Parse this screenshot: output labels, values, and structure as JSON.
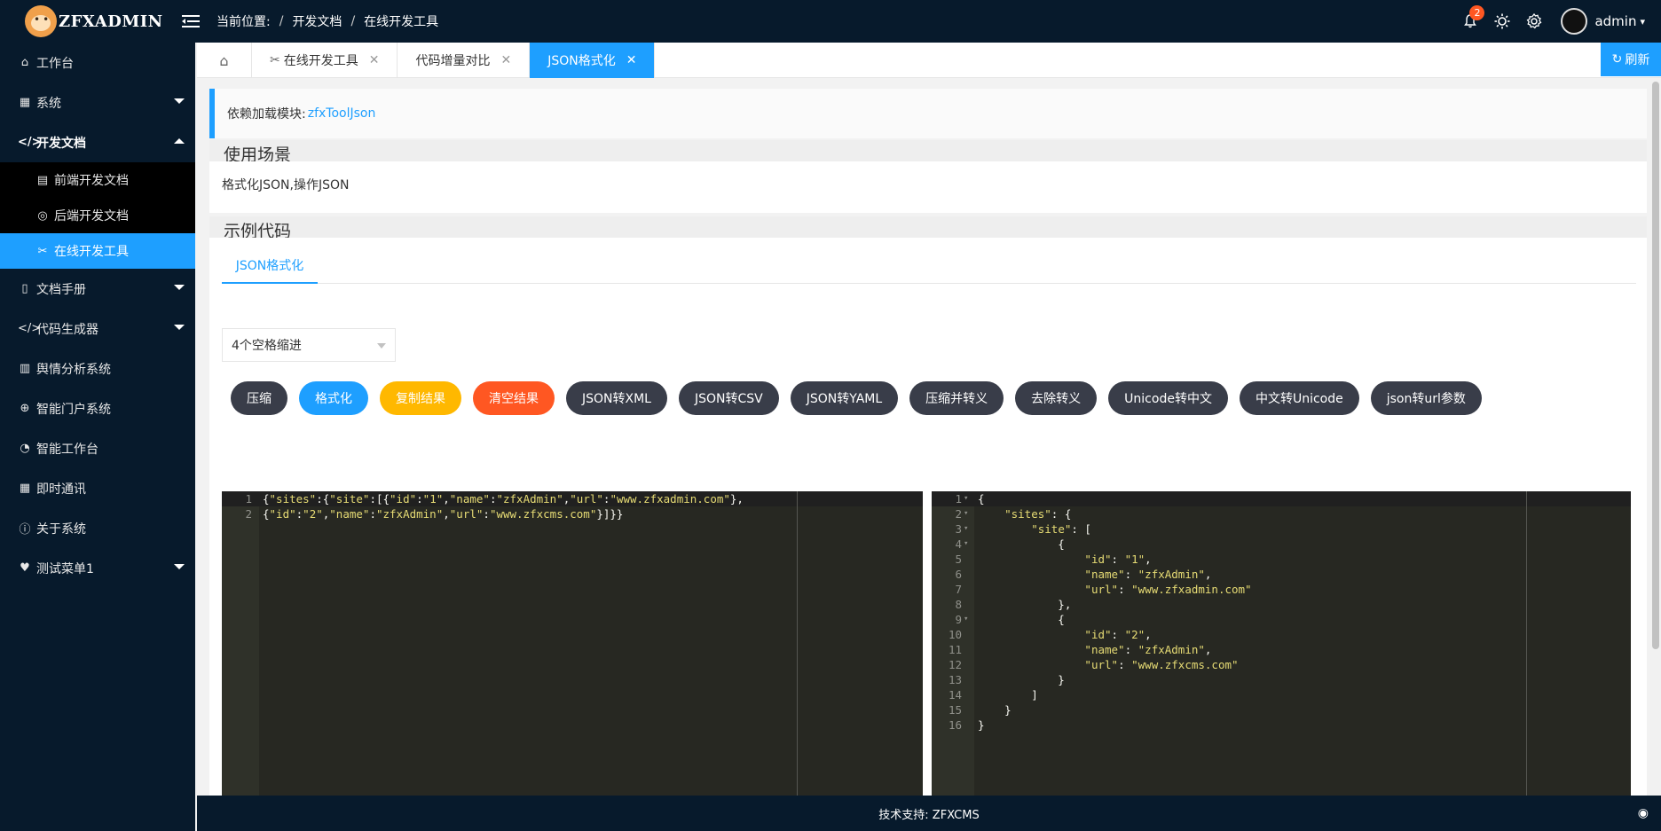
{
  "header": {
    "logo_text": "ZFXADMIN",
    "breadcrumb_label": "当前位置:",
    "breadcrumb": [
      "开发文档",
      "在线开发工具"
    ],
    "notification_count": "2",
    "user_name": "admin"
  },
  "sidebar": {
    "items": [
      {
        "label": "工作台",
        "icon": "home-icon"
      },
      {
        "label": "系统",
        "icon": "apps-icon",
        "arrow": "down"
      },
      {
        "label": "开发文档",
        "icon": "code-icon",
        "arrow": "up",
        "open": true
      },
      {
        "label": "文档手册",
        "icon": "book-icon",
        "arrow": "down"
      },
      {
        "label": "代码生成器",
        "icon": "code-icon",
        "arrow": "down"
      },
      {
        "label": "舆情分析系统",
        "icon": "docs-icon"
      },
      {
        "label": "智能门户系统",
        "icon": "globe-icon"
      },
      {
        "label": "智能工作台",
        "icon": "dashboard-icon"
      },
      {
        "label": "即时通讯",
        "icon": "apps-icon"
      },
      {
        "label": "关于系统",
        "icon": "info-icon"
      },
      {
        "label": "测试菜单1",
        "icon": "heart-icon",
        "arrow": "down"
      }
    ],
    "subitems": [
      {
        "label": "前端开发文档",
        "icon": "doc-icon"
      },
      {
        "label": "后端开发文档",
        "icon": "code-circle-icon"
      },
      {
        "label": "在线开发工具",
        "icon": "tools-icon",
        "active": true
      }
    ]
  },
  "tabs": [
    {
      "label": "在线开发工具"
    },
    {
      "label": "代码增量对比"
    },
    {
      "label": "JSON格式化",
      "active": true
    }
  ],
  "refresh_label": "刷新",
  "content": {
    "dependency_label": "依赖加载模块:",
    "dependency_module": "zfxToolJson",
    "usage_title": "使用场景",
    "usage_text": "格式化JSON,操作JSON",
    "example_title": "示例代码",
    "inner_tab": "JSON格式化",
    "indent_select": "4个空格缩进",
    "buttons": [
      {
        "label": "压缩",
        "style": "dark"
      },
      {
        "label": "格式化",
        "style": "blue"
      },
      {
        "label": "复制结果",
        "style": "yellow"
      },
      {
        "label": "清空结果",
        "style": "red"
      },
      {
        "label": "JSON转XML",
        "style": "dark"
      },
      {
        "label": "JSON转CSV",
        "style": "dark"
      },
      {
        "label": "JSON转YAML",
        "style": "dark"
      },
      {
        "label": "压缩并转义",
        "style": "dark"
      },
      {
        "label": "去除转义",
        "style": "dark"
      },
      {
        "label": "Unicode转中文",
        "style": "dark"
      },
      {
        "label": "中文转Unicode",
        "style": "dark"
      },
      {
        "label": "json转url参数",
        "style": "dark"
      }
    ],
    "input_lines": [
      "{\"sites\":{\"site\":[{\"id\":\"1\",\"name\":\"zfxAdmin\",\"url\":\"www.zfxadmin.com\"},",
      "{\"id\":\"2\",\"name\":\"zfxAdmin\",\"url\":\"www.zfxcms.com\"}]}}"
    ],
    "output_lines": [
      "{",
      "    \"sites\": {",
      "        \"site\": [",
      "            {",
      "                \"id\": \"1\",",
      "                \"name\": \"zfxAdmin\",",
      "                \"url\": \"www.zfxadmin.com\"",
      "            },",
      "            {",
      "                \"id\": \"2\",",
      "                \"name\": \"zfxAdmin\",",
      "                \"url\": \"www.zfxcms.com\"",
      "            }",
      "        ]",
      "    }",
      "}"
    ],
    "output_fold_lines": [
      1,
      2,
      3,
      4,
      9
    ]
  },
  "footer": {
    "text": "技术支持: ZFXCMS"
  }
}
